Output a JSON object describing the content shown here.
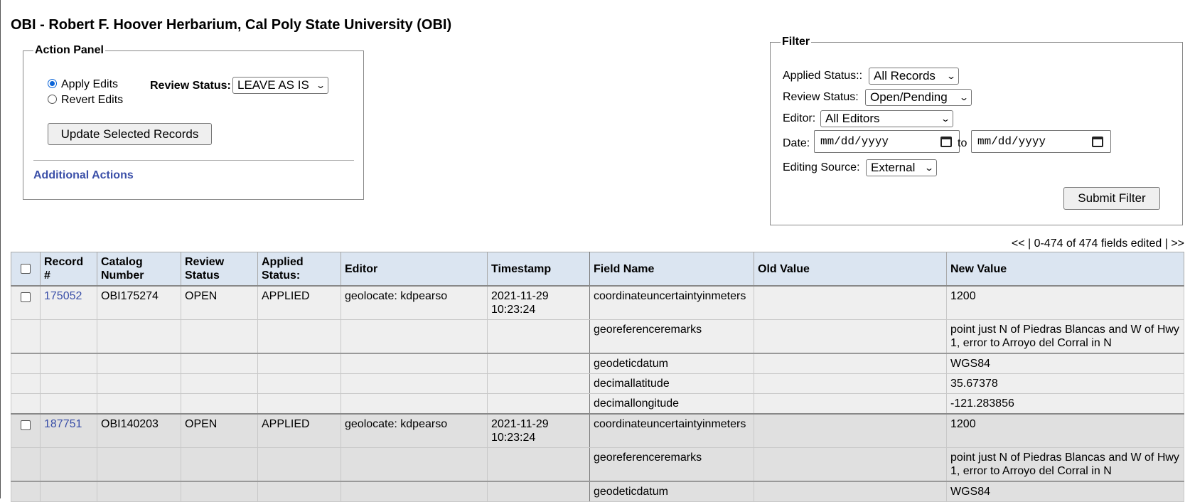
{
  "page": {
    "title": "OBI - Robert F. Hoover Herbarium, Cal Poly State University (OBI)"
  },
  "action_panel": {
    "legend": "Action Panel",
    "apply_label": "Apply Edits",
    "revert_label": "Revert Edits",
    "review_status_label": "Review Status:",
    "review_status_value": "LEAVE AS IS",
    "update_button": "Update Selected Records",
    "additional_actions": "Additional Actions"
  },
  "filter": {
    "legend": "Filter",
    "applied_status_label": "Applied Status::",
    "applied_status_value": "All Records",
    "review_status_label": "Review Status:",
    "review_status_value": "Open/Pending",
    "editor_label": "Editor:",
    "editor_value": "All Editors",
    "date_label": "Date:",
    "date_placeholder": "mm/dd/yyyy",
    "to_label": "to",
    "source_label": "Editing Source:",
    "source_value": "External",
    "submit_button": "Submit Filter"
  },
  "pager": {
    "prev": "<<",
    "sep1": " | ",
    "range": "0-474 of 474 fields edited",
    "sep2": " | ",
    "next": ">>"
  },
  "table": {
    "headers": {
      "record": [
        "Record",
        "#"
      ],
      "catalog": [
        "Catalog",
        "Number"
      ],
      "review": [
        "Review",
        "Status"
      ],
      "applied": [
        "Applied",
        "Status:"
      ],
      "editor": "Editor",
      "timestamp": "Timestamp",
      "field": "Field Name",
      "old": "Old Value",
      "new": "New Value"
    },
    "records": [
      {
        "record": "175052",
        "catalog": "OBI175274",
        "review": "OPEN",
        "applied": "APPLIED",
        "editor": "geolocate: kdpearso",
        "ts_date": "2021-11-29",
        "ts_time": "10:23:24",
        "fields": [
          {
            "name": "coordinateuncertaintyinmeters",
            "old": "",
            "new": "1200"
          },
          {
            "name": "georeferenceremarks",
            "old": "",
            "new": "point just N of Piedras Blancas and W of Hwy 1, error to Arroyo del Corral in N"
          },
          {
            "name": "geodeticdatum",
            "old": "",
            "new": "WGS84"
          },
          {
            "name": "decimallatitude",
            "old": "",
            "new": "35.67378"
          },
          {
            "name": "decimallongitude",
            "old": "",
            "new": "-121.283856"
          }
        ]
      },
      {
        "record": "187751",
        "catalog": "OBI140203",
        "review": "OPEN",
        "applied": "APPLIED",
        "editor": "geolocate: kdpearso",
        "ts_date": "2021-11-29",
        "ts_time": "10:23:24",
        "fields": [
          {
            "name": "coordinateuncertaintyinmeters",
            "old": "",
            "new": "1200"
          },
          {
            "name": "georeferenceremarks",
            "old": "",
            "new": "point just N of Piedras Blancas and W of Hwy 1, error to Arroyo del Corral in N"
          },
          {
            "name": "geodeticdatum",
            "old": "",
            "new": "WGS84"
          }
        ]
      }
    ]
  }
}
